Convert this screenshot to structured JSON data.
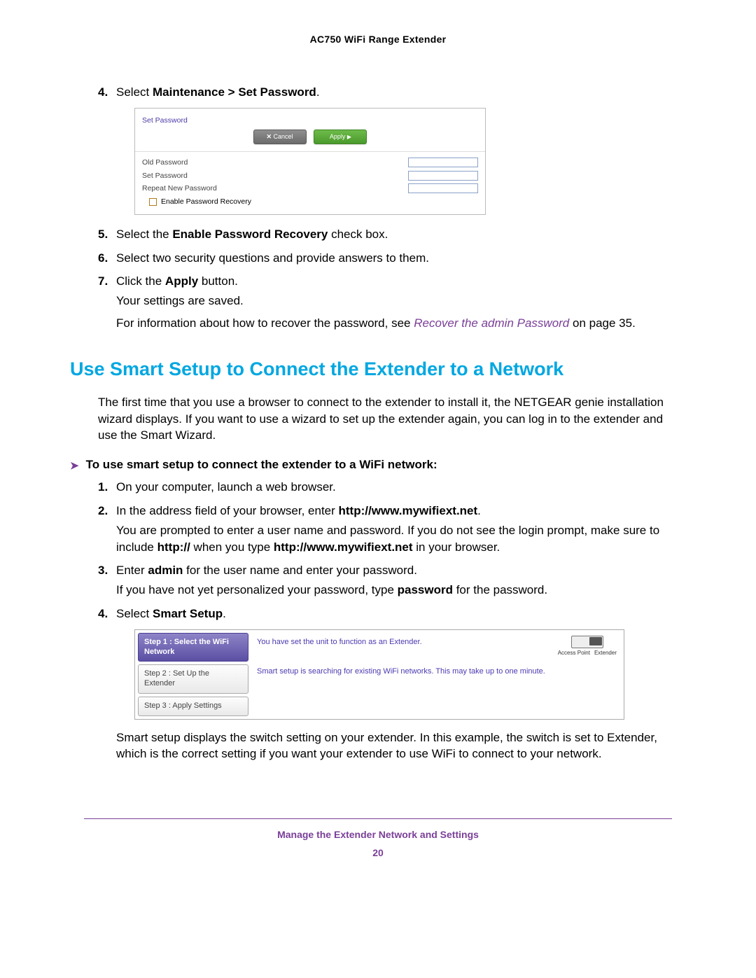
{
  "doc_title": "AC750 WiFi Range Extender",
  "steps_top": {
    "s4": {
      "num": "4.",
      "pre": "Select ",
      "bold": "Maintenance > Set Password",
      "post": "."
    },
    "s5": {
      "num": "5.",
      "pre": "Select the ",
      "bold": "Enable Password Recovery",
      "post": " check box."
    },
    "s6": {
      "num": "6.",
      "text": "Select two security questions and provide answers to them."
    },
    "s7": {
      "num": "7.",
      "pre": "Click the ",
      "bold": "Apply",
      "post": " button."
    },
    "s7_p1": "Your settings are saved.",
    "s7_p2_a": "For information about how to recover the password, see ",
    "s7_p2_link": "Recover the admin Password",
    "s7_p2_b": " on page 35."
  },
  "panel1": {
    "title": "Set Password",
    "cancel": "Cancel",
    "apply": "Apply",
    "old": "Old Password",
    "set": "Set Password",
    "repeat": "Repeat New Password",
    "enable": "Enable Password Recovery"
  },
  "section_heading": "Use Smart Setup to Connect the Extender to a Network",
  "section_intro": "The first time that you use a browser to connect to the extender to install it, the NETGEAR genie installation wizard displays. If you want to use a wizard to set up the extender again, you can log in to the extender and use the Smart Wizard.",
  "subhead": "To use smart setup to connect the extender to a WiFi network:",
  "steps_bottom": {
    "s1": {
      "num": "1.",
      "text": "On your computer, launch a web browser."
    },
    "s2": {
      "num": "2.",
      "pre": "In the address field of your browser, enter ",
      "bold": "http://www.mywifiext.net",
      "post": "."
    },
    "s2_p1": "You are prompted to enter a user name and password. If you do not see the login prompt, make sure to include ",
    "s2_p1_b1": "http://",
    "s2_p1_mid": " when you type ",
    "s2_p1_b2": "http://www.mywifiext.net",
    "s2_p1_end": " in your browser.",
    "s3": {
      "num": "3.",
      "pre": "Enter ",
      "bold": "admin",
      "post": " for the user name and enter your password."
    },
    "s3_p1_a": "If you have not yet personalized your password, type ",
    "s3_p1_bold": "password",
    "s3_p1_b": " for the password.",
    "s4": {
      "num": "4.",
      "pre": "Select ",
      "bold": "Smart Setup",
      "post": "."
    }
  },
  "panel2": {
    "tab1": "Step 1 : Select the WiFi Network",
    "tab2": "Step 2 : Set Up the Extender",
    "tab3": "Step 3 : Apply Settings",
    "top_msg": "You have set the unit to function as an Extender.",
    "switch_left": "Access Point",
    "switch_right": "Extender",
    "search_msg": "Smart setup is searching for existing WiFi networks. This may take up to one minute."
  },
  "after_panel2": "Smart setup displays the switch setting on your extender. In this example, the switch is set to Extender, which is the correct setting if you want your extender to use WiFi to connect to your network.",
  "footer": {
    "line1": "Manage the Extender Network and Settings",
    "page": "20"
  }
}
